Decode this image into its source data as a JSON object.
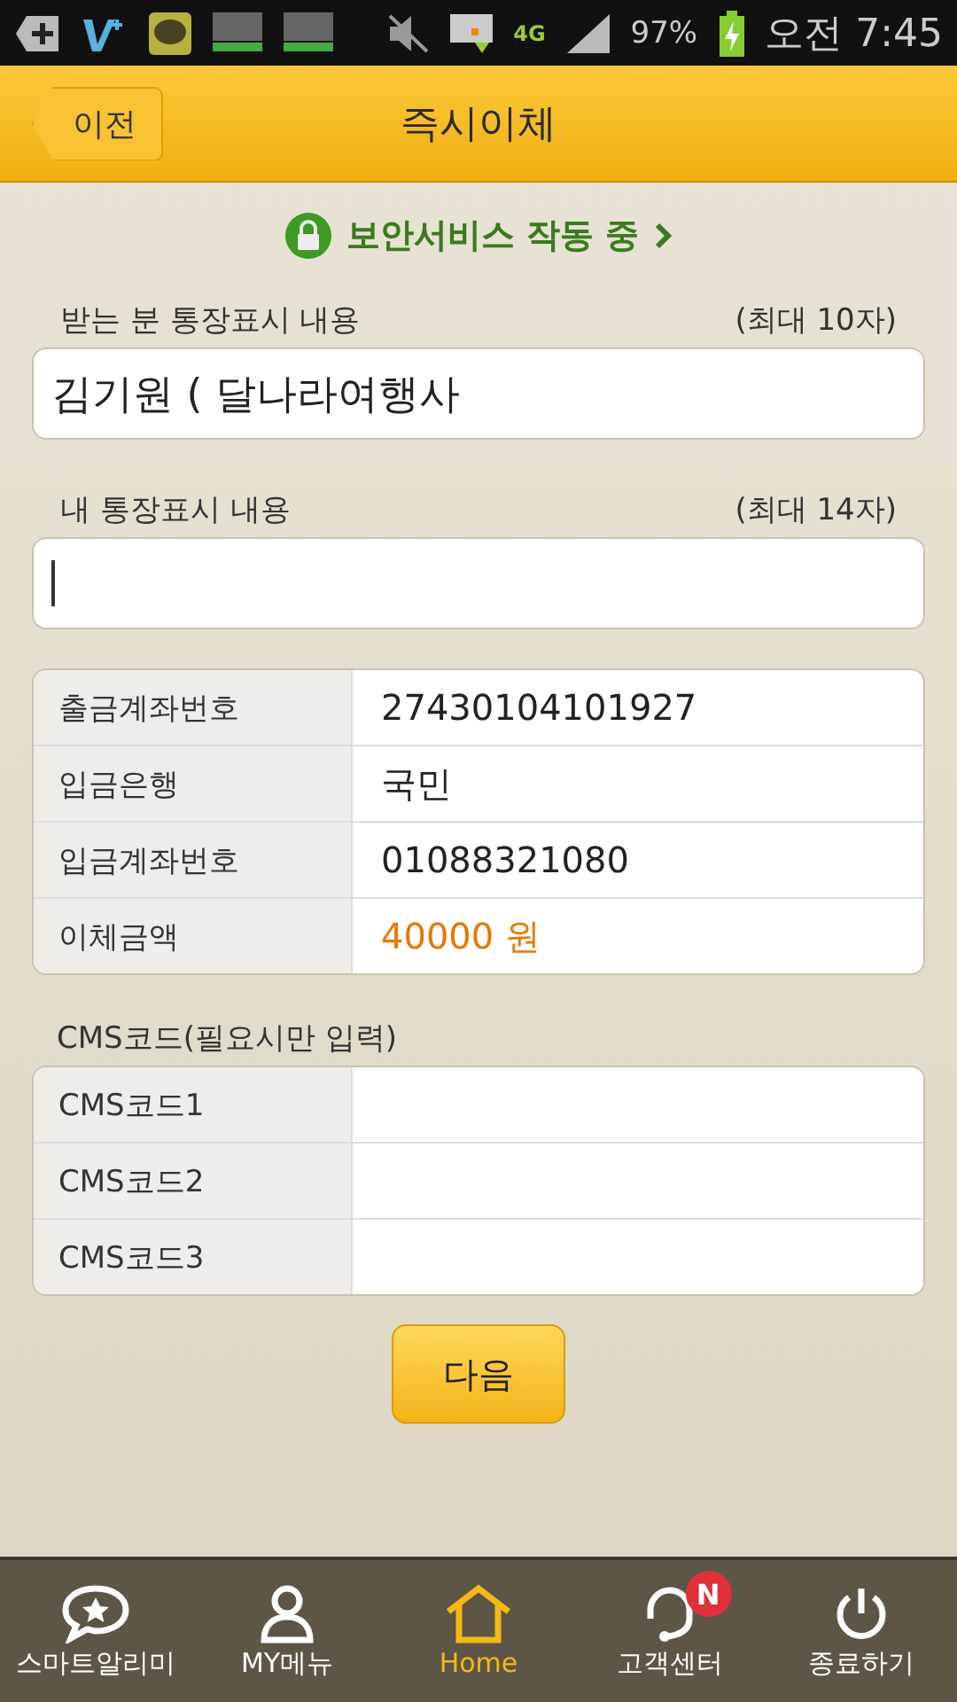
{
  "status_bar": {
    "network": "4G",
    "battery": "97%",
    "time": "오전 7:45"
  },
  "header": {
    "back": "이전",
    "title": "즉시이체"
  },
  "security": {
    "label": "보안서비스 작동 중"
  },
  "fields": [
    {
      "label": "받는 분 통장표시 내용",
      "limit": "(최대 10자)",
      "value": "김기원 ( 달나라여행사",
      "focused": false
    },
    {
      "label": "내 통장표시 내용",
      "limit": "(최대 14자)",
      "focused": true
    }
  ],
  "transfer_table": [
    {
      "label": "출금계좌번호",
      "value": "27430104101927",
      "kind": "plain"
    },
    {
      "label": "입금은행",
      "value": "국민",
      "kind": "plain"
    },
    {
      "label": "입금계좌번호",
      "value": "01088321080",
      "kind": "plain"
    },
    {
      "label": "이체금액",
      "value": "40000 원",
      "kind": "amount"
    }
  ],
  "cms": {
    "title": "CMS코드(필요시만 입력)",
    "rows": [
      {
        "label": "CMS코드1"
      },
      {
        "label": "CMS코드2"
      },
      {
        "label": "CMS코드3"
      }
    ]
  },
  "next_button": "다음",
  "bottom_nav": [
    {
      "label": "스마트알리미",
      "kind": "chat",
      "selected": false
    },
    {
      "label": "MY메뉴",
      "kind": "person",
      "selected": false
    },
    {
      "label": "Home",
      "kind": "home",
      "selected": true
    },
    {
      "label": "고객센터",
      "kind": "headset",
      "selected": false,
      "badge": "N"
    },
    {
      "label": "종료하기",
      "kind": "power",
      "selected": false
    }
  ]
}
